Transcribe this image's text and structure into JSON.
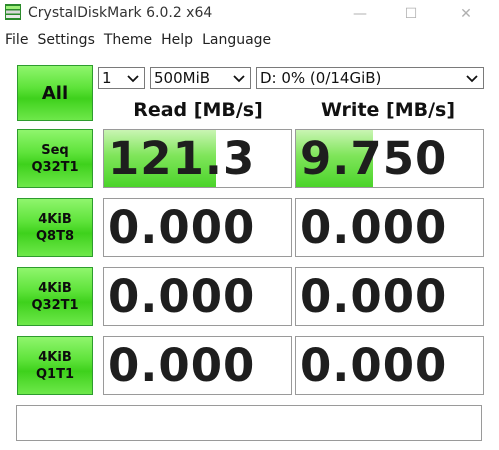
{
  "window": {
    "title": "CrystalDiskMark 6.0.2 x64",
    "controls": {
      "minimize": "—",
      "maximize": "☐",
      "close": "✕"
    }
  },
  "menu": [
    "File",
    "Settings",
    "Theme",
    "Help",
    "Language"
  ],
  "toolbar": {
    "all_label": "All",
    "count_value": "1",
    "size_value": "500MiB",
    "drive_value": "D: 0% (0/14GiB)"
  },
  "headers": {
    "read": "Read [MB/s]",
    "write": "Write [MB/s]"
  },
  "tests": [
    {
      "line1": "Seq",
      "line2": "Q32T1",
      "read": "121.3",
      "write": "9.750",
      "read_fill": 0.6,
      "write_fill": 0.41
    },
    {
      "line1": "4KiB",
      "line2": "Q8T8",
      "read": "0.000",
      "write": "0.000",
      "read_fill": 0,
      "write_fill": 0
    },
    {
      "line1": "4KiB",
      "line2": "Q32T1",
      "read": "0.000",
      "write": "0.000",
      "read_fill": 0,
      "write_fill": 0
    },
    {
      "line1": "4KiB",
      "line2": "Q1T1",
      "read": "0.000",
      "write": "0.000",
      "read_fill": 0,
      "write_fill": 0
    }
  ],
  "comment": "",
  "colors": {
    "button_green": "#4fd92a",
    "bar_green": "#7fe55a"
  },
  "icons": {
    "app": "crystaldiskmark-icon",
    "dropdown": "chevron-down-icon"
  }
}
